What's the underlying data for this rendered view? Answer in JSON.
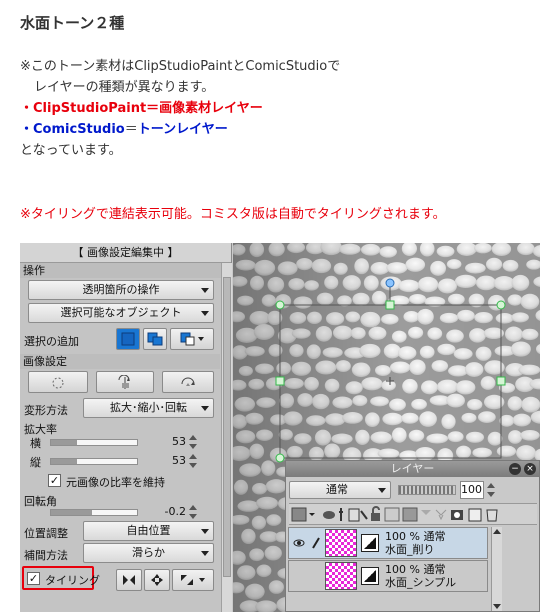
{
  "heading": "水面トーン２種",
  "description": {
    "line1": "※このトーン素材はClipStudioPaintとComicStudioで",
    "line2": "レイヤーの種類が異なります。",
    "line3_prefix": "・",
    "line3": "ClipStudioPaint＝画像素材レイヤー",
    "line4_prefix": "・",
    "line4_name": "ComicStudio",
    "line4_eq": "＝",
    "line4_value": "トーンレイヤー",
    "line5": "となっています。"
  },
  "tiling_note": "※タイリングで連結表示可能。コミスタ版は自動でタイリングされます。",
  "panel": {
    "title": "【 画像設定編集中 】",
    "section_operation": "操作",
    "transparent_op": "透明箇所の操作",
    "selectable_objects": "選択可能なオブジェクト",
    "selection_add_label": "選択の追加",
    "section_image": "画像設定",
    "transform_label": "変形方法",
    "transform_value": "拡大･縮小･回転",
    "section_scale": "拡大率",
    "width_label": "横",
    "width_value": "53",
    "height_label": "縦",
    "height_value": "53",
    "keep_ratio_label": "元画像の比率を維持",
    "keep_ratio_checked": "✓",
    "section_rotation": "回転角",
    "rotation_value": "-0.2",
    "position_label": "位置調整",
    "position_value": "自由位置",
    "interp_label": "補間方法",
    "interp_value": "滑らか",
    "tiling_label": "タイリング",
    "tiling_checked": "✓"
  },
  "layers": {
    "title": "レイヤー",
    "blend_mode": "通常",
    "opacity": "100",
    "items": [
      {
        "percent": "100 %",
        "mode": "通常",
        "name": "水面_削り"
      },
      {
        "percent": "100 %",
        "mode": "通常",
        "name": "水面_シンプル"
      }
    ]
  },
  "colors": {
    "red": "#e8000c",
    "blue": "#0019cc",
    "handle_green": "#35b84b",
    "selected_tool": "#1976d2"
  }
}
